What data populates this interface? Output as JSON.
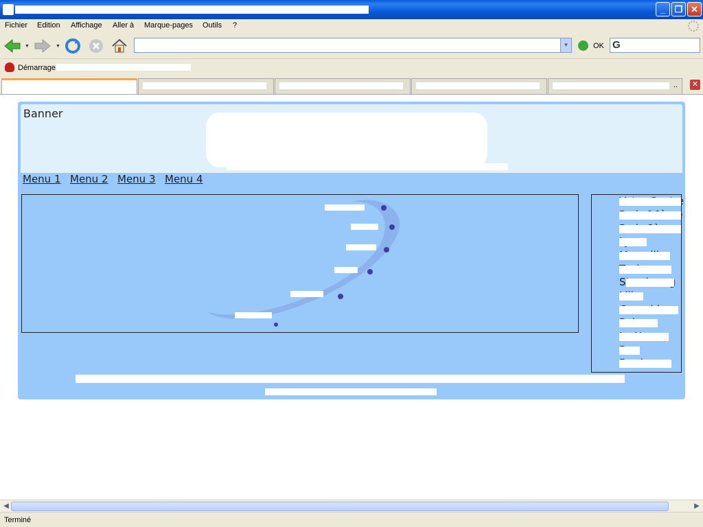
{
  "window": {
    "title": ""
  },
  "menubar": {
    "items": [
      "Fichier",
      "Edition",
      "Affichage",
      "Aller à",
      "Marque-pages",
      "Outils",
      "?"
    ]
  },
  "navbar": {
    "url": "",
    "go_label": "OK"
  },
  "bookmarks": {
    "first": "Démarrage"
  },
  "page": {
    "banner_label": "Banner",
    "menus": [
      "Menu 1",
      "Menu 2",
      "Menu 3",
      "Menu 4"
    ],
    "side_items": [
      "Votre Centre",
      "Paris 16ème",
      "Paris 8ème",
      "Lyon",
      "Marseille",
      "Toulouse",
      "Strasbourg",
      "Lille",
      "Grenoble",
      "Reims",
      "Le Havre",
      "Pau",
      "Bordeaux"
    ]
  },
  "status": {
    "text": "Terminé"
  },
  "colors": {
    "page_bg": "#99c9fb",
    "banner_bg": "#e0f1fc",
    "titlebar": "#0a5bd8"
  }
}
